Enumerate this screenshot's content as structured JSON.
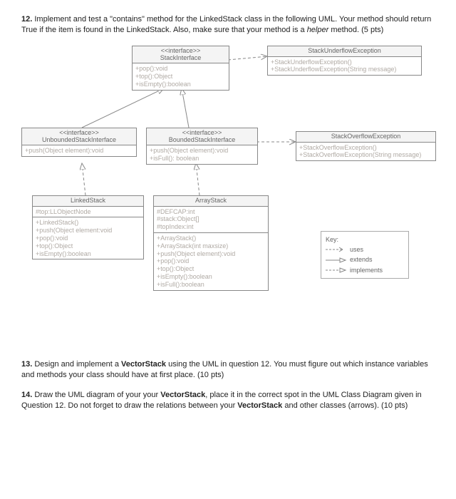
{
  "q12": {
    "num": "12.",
    "text_a": "Implement and test a \"contains\" method for the LinkedStack class in the following UML. Your method should return True if the item is found in the LinkedStack. Also, make sure that your method is a ",
    "text_b": "helper",
    "text_c": " method. (5 pts)"
  },
  "q13": {
    "num": "13.",
    "text_a": "Design and implement a ",
    "text_b": "VectorStack",
    "text_c": " using the UML in question 12. You must figure out which instance variables and methods your class should have at first place. (10 pts)"
  },
  "q14": {
    "num": "14.",
    "text_a": "Draw the UML diagram of your your ",
    "text_b": "VectorStack",
    "text_c": ", place it in the correct spot in the UML Class Diagram given in Question 12. Do not forget to draw the relations between your ",
    "text_d": "VectorStack",
    "text_e": " and other classes (arrows). (10 pts)"
  },
  "stackInterface": {
    "stereo": "<<interface>>",
    "name": "StackInterface",
    "methods": "+pop():void\n+top():Object\n+isEmpty():boolean"
  },
  "stackUnderflow": {
    "name": "StackUnderflowException",
    "methods": "+StackUnderflowException()\n+StackUnderflowException(String message)"
  },
  "unbounded": {
    "stereo": "<<interface>>",
    "name": "UnboundedStackInterface",
    "methods": "+push(Object element):void"
  },
  "bounded": {
    "stereo": "<<interface>>",
    "name": "BoundedStackInterface",
    "methods": "+push(Object element):void\n+isFull(): boolean"
  },
  "stackOverflow": {
    "name": "StackOverflowException",
    "methods": "+StackOverflowException()\n+StackOverflowException(String message)"
  },
  "linkedStack": {
    "name": "LinkedStack",
    "attrs": "#top:LLObjectNode",
    "methods": "+LinkedStack()\n+push(Object element:void\n+pop():void\n+top():Object\n+isEmpty():boolean"
  },
  "arrayStack": {
    "name": "ArrayStack",
    "attrs": "#DEFCAP:int\n#stack:Object[]\n#topIndex:int",
    "methods": "+ArrayStack()\n+ArrayStack(int maxsize)\n+push(Object element):void\n+pop():void\n+top():Object\n+isEmpty():boolean\n+isFull():boolean"
  },
  "key": {
    "title": "Key:",
    "uses": "uses",
    "extends": "extends",
    "implements": "implements"
  }
}
